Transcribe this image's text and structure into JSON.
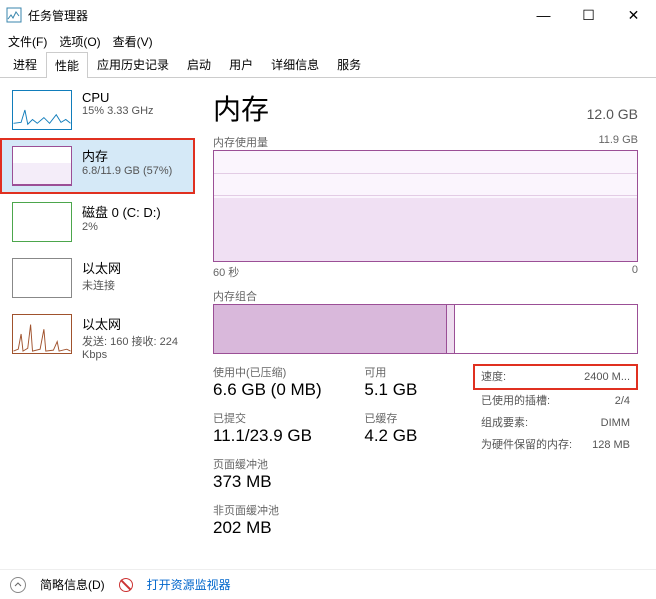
{
  "window": {
    "title": "任务管理器"
  },
  "menu": [
    "文件(F)",
    "选项(O)",
    "查看(V)"
  ],
  "tabs": [
    "进程",
    "性能",
    "应用历史记录",
    "启动",
    "用户",
    "详细信息",
    "服务"
  ],
  "active_tab": "性能",
  "sidebar": [
    {
      "title": "CPU",
      "sub": "15% 3.33 GHz"
    },
    {
      "title": "内存",
      "sub": "6.8/11.9 GB (57%)"
    },
    {
      "title": "磁盘 0 (C: D:)",
      "sub": "2%"
    },
    {
      "title": "以太网",
      "sub": "未连接"
    },
    {
      "title": "以太网",
      "sub": "发送: 160 接收: 224 Kbps"
    }
  ],
  "main": {
    "title": "内存",
    "total": "12.0 GB",
    "usage_label": "内存使用量",
    "usage_max": "11.9 GB",
    "time_left": "60 秒",
    "time_right": "0",
    "comp_label": "内存组合",
    "stats": {
      "in_use_label": "使用中(已压缩)",
      "in_use": "6.6 GB (0 MB)",
      "avail_label": "可用",
      "avail": "5.1 GB",
      "committed_label": "已提交",
      "committed": "11.1/23.9 GB",
      "cached_label": "已缓存",
      "cached": "4.2 GB",
      "paged_label": "页面缓冲池",
      "paged": "373 MB",
      "nonpaged_label": "非页面缓冲池",
      "nonpaged": "202 MB"
    },
    "info": {
      "speed_l": "速度:",
      "speed_v": "2400 M...",
      "slots_l": "已使用的插槽:",
      "slots_v": "2/4",
      "form_l": "组成要素:",
      "form_v": "DIMM",
      "reserved_l": "为硬件保留的内存:",
      "reserved_v": "128 MB"
    }
  },
  "footer": {
    "fewer": "简略信息(D)",
    "monitor": "打开资源监视器"
  },
  "chart_data": {
    "type": "line",
    "title": "内存使用量",
    "xlabel": "60 秒",
    "ylabel": "",
    "ylim": [
      0,
      11.9
    ],
    "x_seconds": [
      60,
      0
    ],
    "series": [
      {
        "name": "内存",
        "values_gb": [
          6.8,
          6.8,
          6.8,
          6.8,
          6.8,
          6.8,
          6.8,
          6.8,
          6.8,
          6.8
        ]
      }
    ],
    "composition_gb": {
      "in_use": 6.6,
      "modified": 0.2,
      "standby": 4.2,
      "free": 0.9,
      "total": 11.9
    }
  }
}
